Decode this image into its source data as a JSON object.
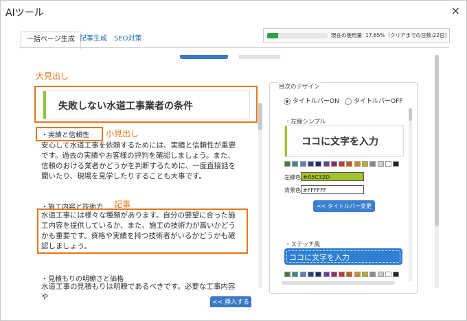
{
  "window": {
    "title": "AIツール",
    "close_label": "×"
  },
  "tabs": [
    {
      "label": "一括ページ生成",
      "active": true
    },
    {
      "label": "記事生成",
      "active": false
    },
    {
      "label": "SEO対策",
      "active": false
    }
  ],
  "usage": {
    "text": "現在の使用量: 17.65%（クリアまでの日数:22日)",
    "percent": 17.65,
    "bar_color": "#2ea24a"
  },
  "annotations": {
    "large_heading": "大見出し",
    "small_heading": "小見出し",
    "article": "記事",
    "color": "#e8751a"
  },
  "article": {
    "title": "失敗しない水道工事業者の条件",
    "sections": [
      {
        "heading": "・実績と信頼性",
        "body": "安心して水道工事を依頼するためには、実績と信頼性が重要です。過去の実績やお客様の評判を確認しましょう。また、信頼のおける業者かどうかを判断するために、一度直接話を聞いたり、現場を見学したりすることも大事です。"
      },
      {
        "heading": "・施工内容と技術力",
        "body": "水道工事には様々な種類があります。自分の要望に合った施工内容を提供しているか、また、施工の技術力が高いかどうかも重要です。資格や実績を持つ技術者がいるかどうかも確認しましょう。"
      },
      {
        "heading": "・見積もりの明瞭さと価格",
        "body": "水道工事の見積もりは明瞭であるべきです。必要な工事内容や"
      }
    ]
  },
  "insert_button": "<< 挿入する",
  "design": {
    "legend": "目次のデザイン",
    "radio_on": "タイトルバーON",
    "radio_off": "タイトルバーOFF",
    "style1_label": "・左線シンプル",
    "preview_text": "ココに文字を入力",
    "swatches": [
      "#4a7a3a",
      "#3b8a8a",
      "#5a7fc0",
      "#2a3f8f",
      "#1c2f5a",
      "#6a3fa0",
      "#8a2f6a",
      "#c03a3a",
      "#c05a20",
      "#d08a20",
      "#b8b020",
      "#888888",
      "#cccccc",
      "#ffffff",
      "#222222"
    ],
    "left_line_label": "左線色",
    "left_line_value": "#A5C32D",
    "bg_label": "背景色",
    "bg_value": "#FFFFFF",
    "change_button": "<< タイトルバー変更",
    "style2_label": "・ステッチ風",
    "accent": "#a5c32d",
    "stitch_color": "#2f7fd2"
  }
}
